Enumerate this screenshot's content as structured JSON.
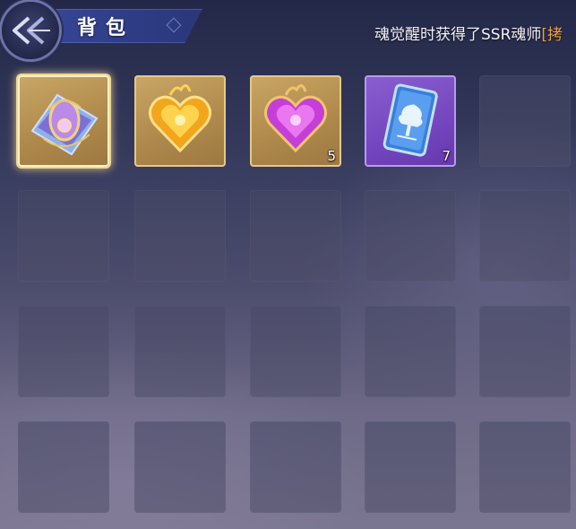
{
  "header": {
    "title": "背包",
    "marquee_text": "魂觉醒时获得了SSR魂师",
    "marquee_tail": "[拷"
  },
  "inventory": {
    "rows": 4,
    "columns": 5,
    "items": [
      {
        "icon": "purple-scroll-icon",
        "count": "",
        "background": "gold",
        "selected": true
      },
      {
        "icon": "gold-heart-crystal-icon",
        "count": "",
        "background": "gold",
        "selected": false
      },
      {
        "icon": "purple-heart-crystal-icon",
        "count": "5",
        "background": "gold",
        "selected": false
      },
      {
        "icon": "blue-tree-card-icon",
        "count": "7",
        "background": "purple",
        "selected": false
      }
    ]
  },
  "colors": {
    "title_banner": "#2e3d86",
    "gold_slot": "#b08a4c",
    "purple_slot": "#7446bf",
    "marquee_highlight": "#f0a040"
  }
}
